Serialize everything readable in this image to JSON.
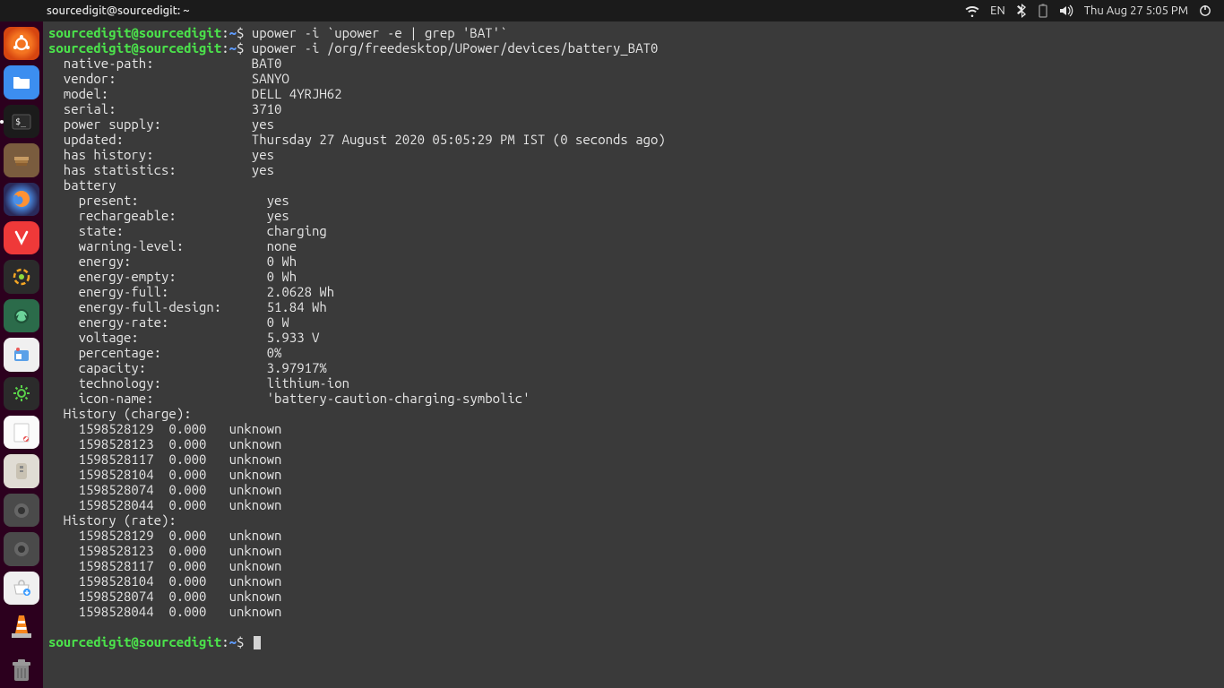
{
  "topbar": {
    "title": "sourcedigit@sourcedigit: ~",
    "lang": "EN",
    "clock": "Thu Aug 27  5:05 PM"
  },
  "prompt": {
    "user_host": "sourcedigit@sourcedigit",
    "sep": ":",
    "path": "~",
    "dollar": "$"
  },
  "cmds": {
    "cmd1": "upower -i `upower -e | grep 'BAT'`",
    "cmd2": "upower -i /org/freedesktop/UPower/devices/battery_BAT0"
  },
  "out": {
    "kv": [
      [
        "  native-path:",
        "BAT0"
      ],
      [
        "  vendor:",
        "SANYO"
      ],
      [
        "  model:",
        "DELL 4YRJH62"
      ],
      [
        "  serial:",
        "3710"
      ],
      [
        "  power supply:",
        "yes"
      ],
      [
        "  updated:",
        "Thursday 27 August 2020 05:05:29 PM IST (0 seconds ago)"
      ],
      [
        "  has history:",
        "yes"
      ],
      [
        "  has statistics:",
        "yes"
      ]
    ],
    "battery_header": "  battery",
    "battery": [
      [
        "    present:",
        "yes"
      ],
      [
        "    rechargeable:",
        "yes"
      ],
      [
        "    state:",
        "charging"
      ],
      [
        "    warning-level:",
        "none"
      ],
      [
        "    energy:",
        "0 Wh"
      ],
      [
        "    energy-empty:",
        "0 Wh"
      ],
      [
        "    energy-full:",
        "2.0628 Wh"
      ],
      [
        "    energy-full-design:",
        "51.84 Wh"
      ],
      [
        "    energy-rate:",
        "0 W"
      ],
      [
        "    voltage:",
        "5.933 V"
      ],
      [
        "    percentage:",
        "0%"
      ],
      [
        "    capacity:",
        "3.97917%"
      ],
      [
        "    technology:",
        "lithium-ion"
      ],
      [
        "    icon-name:",
        "'battery-caution-charging-symbolic'"
      ]
    ],
    "hist_charge_header": "  History (charge):",
    "hist_charge": [
      [
        "1598528129",
        "0.000",
        "unknown"
      ],
      [
        "1598528123",
        "0.000",
        "unknown"
      ],
      [
        "1598528117",
        "0.000",
        "unknown"
      ],
      [
        "1598528104",
        "0.000",
        "unknown"
      ],
      [
        "1598528074",
        "0.000",
        "unknown"
      ],
      [
        "1598528044",
        "0.000",
        "unknown"
      ]
    ],
    "hist_rate_header": "  History (rate):",
    "hist_rate": [
      [
        "1598528129",
        "0.000",
        "unknown"
      ],
      [
        "1598528123",
        "0.000",
        "unknown"
      ],
      [
        "1598528117",
        "0.000",
        "unknown"
      ],
      [
        "1598528104",
        "0.000",
        "unknown"
      ],
      [
        "1598528074",
        "0.000",
        "unknown"
      ],
      [
        "1598528044",
        "0.000",
        "unknown"
      ]
    ]
  },
  "dock_items": [
    "ubuntu",
    "files",
    "terminal",
    "nautilus",
    "firefox",
    "vivaldi",
    "app1",
    "screenshot",
    "app2",
    "settings",
    "notes",
    "archive",
    "app3",
    "app4",
    "software",
    "vlc"
  ]
}
